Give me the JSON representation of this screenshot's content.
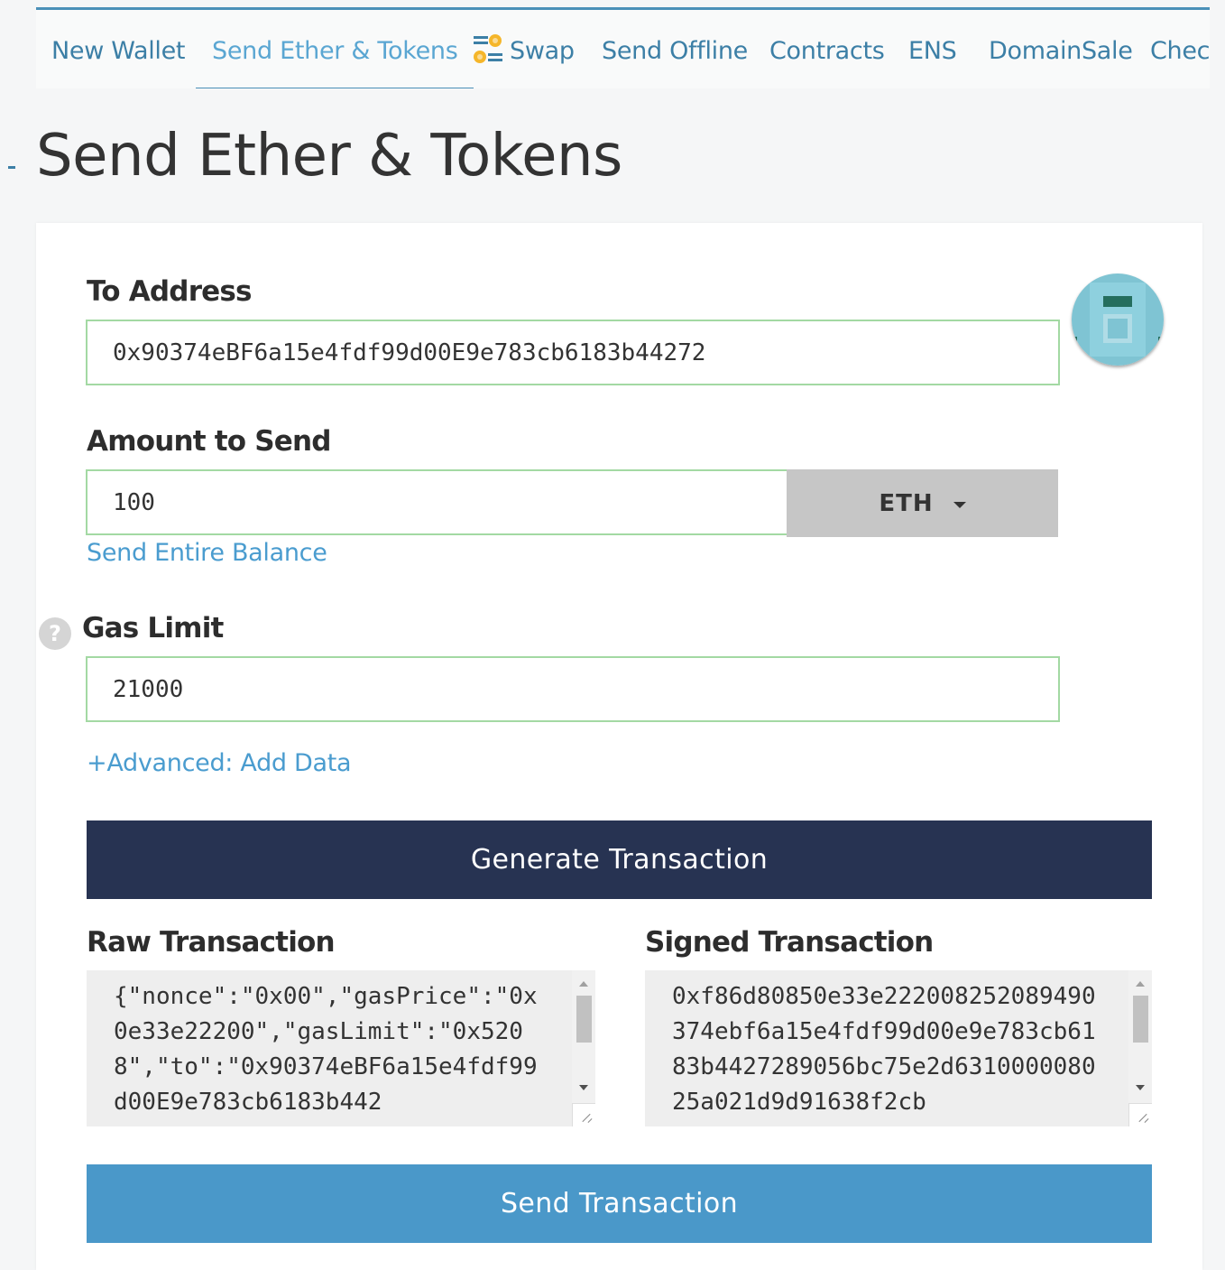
{
  "nav": {
    "items": [
      {
        "label": "New Wallet"
      },
      {
        "label": "Send Ether & Tokens"
      },
      {
        "label": "Swap"
      },
      {
        "label": "Send Offline"
      },
      {
        "label": "Contracts"
      },
      {
        "label": "ENS"
      },
      {
        "label": "DomainSale"
      },
      {
        "label": "Check"
      }
    ],
    "active": "Send Ether & Tokens",
    "swap_icon": "swap-icon"
  },
  "page": {
    "title": "Send Ether & Tokens"
  },
  "form": {
    "to_address": {
      "label": "To Address",
      "value": "0x90374eBF6a15e4fdf99d00E9e783cb6183b44272",
      "identicon": "identicon-avatar"
    },
    "amount": {
      "label": "Amount to Send",
      "value": "100",
      "unit": "ETH",
      "send_entire_balance": "Send Entire Balance"
    },
    "gas": {
      "label": "Gas Limit",
      "value": "21000",
      "help_glyph": "?"
    },
    "advanced_link": "+Advanced: Add Data",
    "generate_button": "Generate Transaction",
    "raw": {
      "label": "Raw Transaction",
      "text": "{\"nonce\":\"0x00\",\"gasPrice\":\"0x0e33e22200\",\"gasLimit\":\"0x5208\",\"to\":\"0x90374eBF6a15e4fdf99d00E9e783cb6183b442"
    },
    "signed": {
      "label": "Signed Transaction",
      "text": "0xf86d80850e33e222008252089490374ebf6a15e4fdf99d00e9e783cb6183b4427289056bc75e2d631000008025a021d9d91638f2cb"
    },
    "send_button": "Send Transaction"
  },
  "colors": {
    "nav_link": "#3c7fa6",
    "nav_active": "#5aa6d2",
    "input_border": "#a3d9a3",
    "generate_bg": "#273352",
    "send_bg": "#4a98c9",
    "dropdown_bg": "#c6c6c6"
  }
}
